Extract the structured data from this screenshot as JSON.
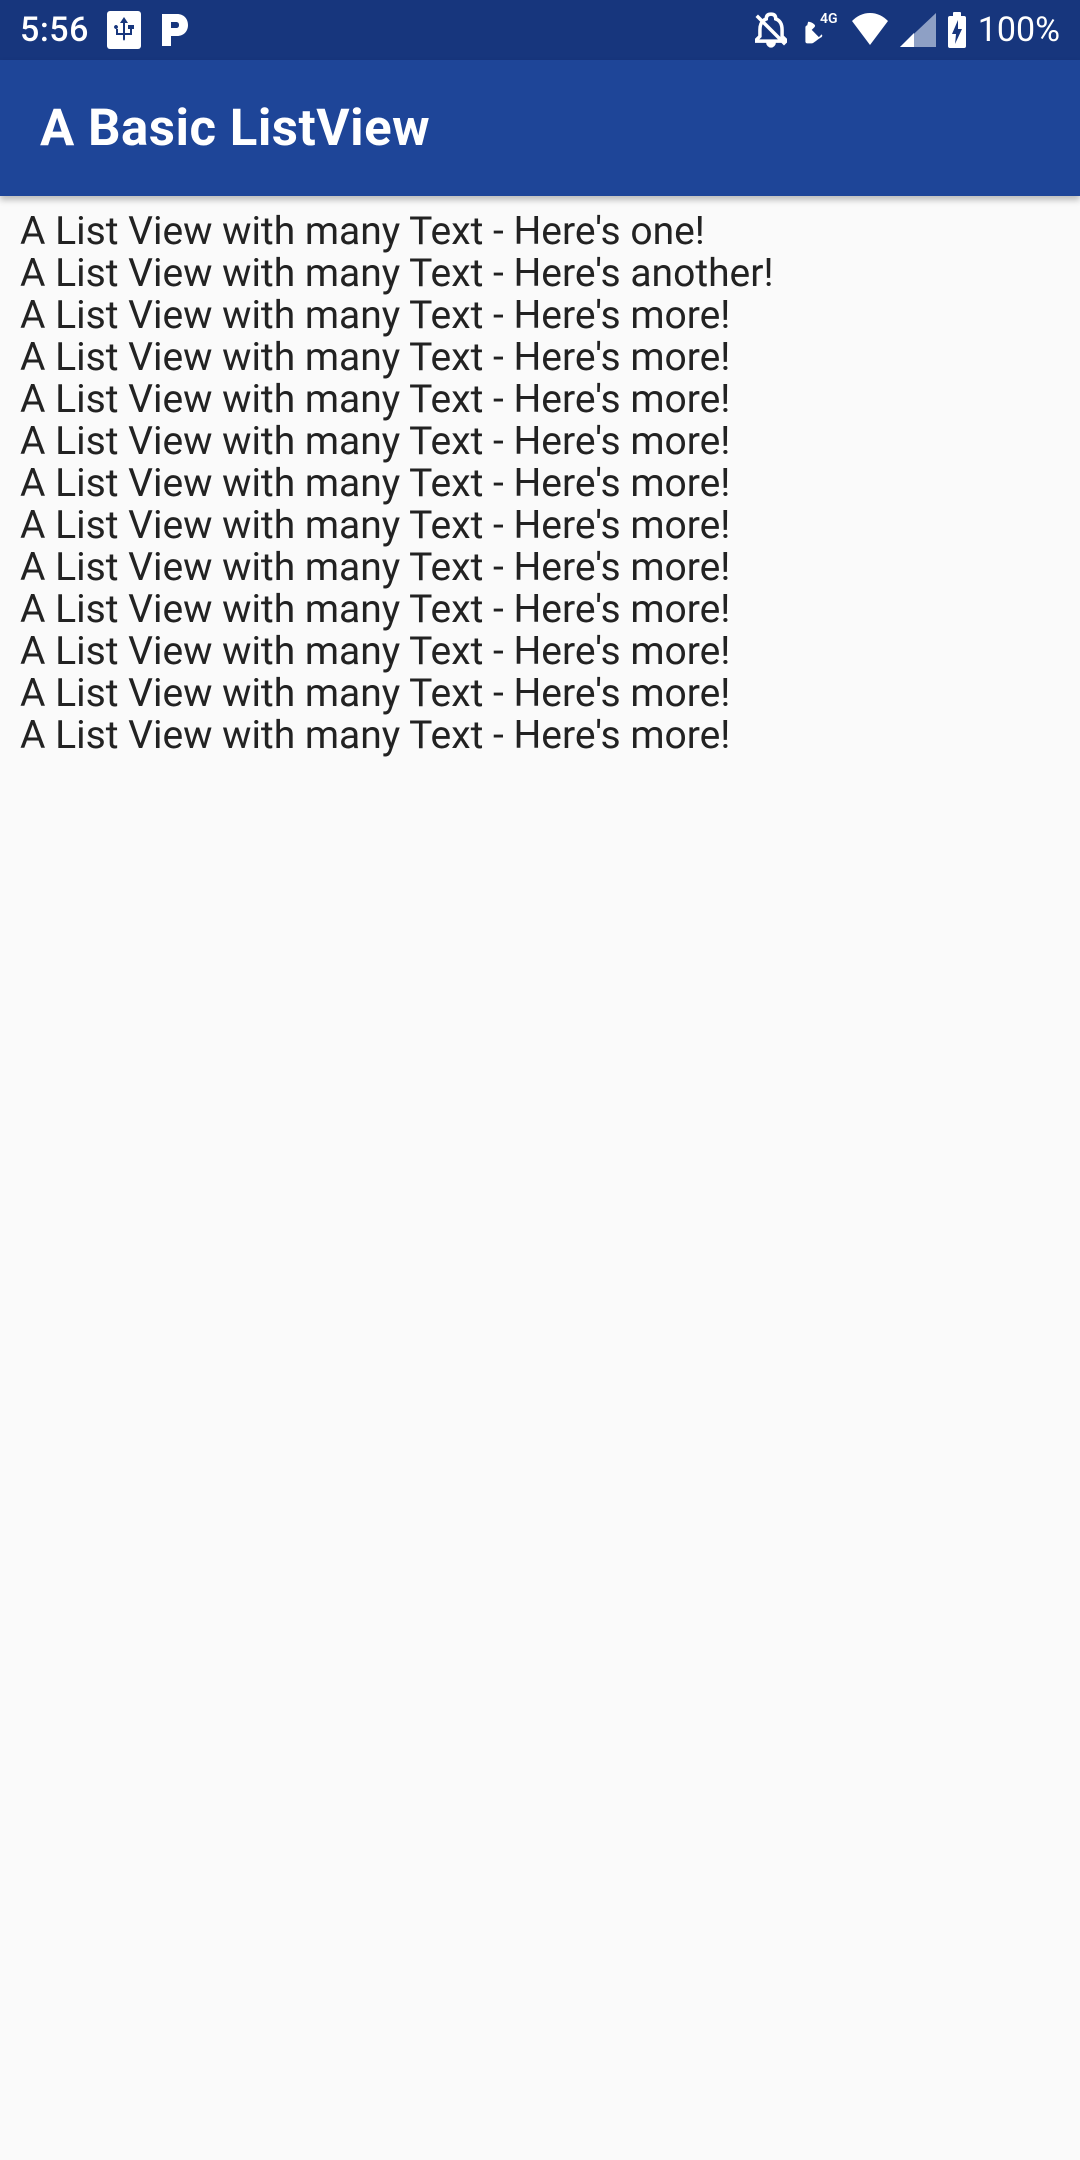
{
  "status_bar": {
    "time": "5:56",
    "battery_percent": "100%"
  },
  "app_bar": {
    "title": "A Basic ListView"
  },
  "list": {
    "items": [
      "A List View with many Text - Here's one!",
      "A List View with many Text - Here's another!",
      "A List View with many Text - Here's more!",
      "A List View with many Text - Here's more!",
      "A List View with many Text - Here's more!",
      "A List View with many Text - Here's more!",
      "A List View with many Text - Here's more!",
      "A List View with many Text - Here's more!",
      "A List View with many Text - Here's more!",
      "A List View with many Text - Here's more!",
      "A List View with many Text - Here's more!",
      "A List View with many Text - Here's more!",
      "A List View with many Text - Here's more!"
    ]
  }
}
